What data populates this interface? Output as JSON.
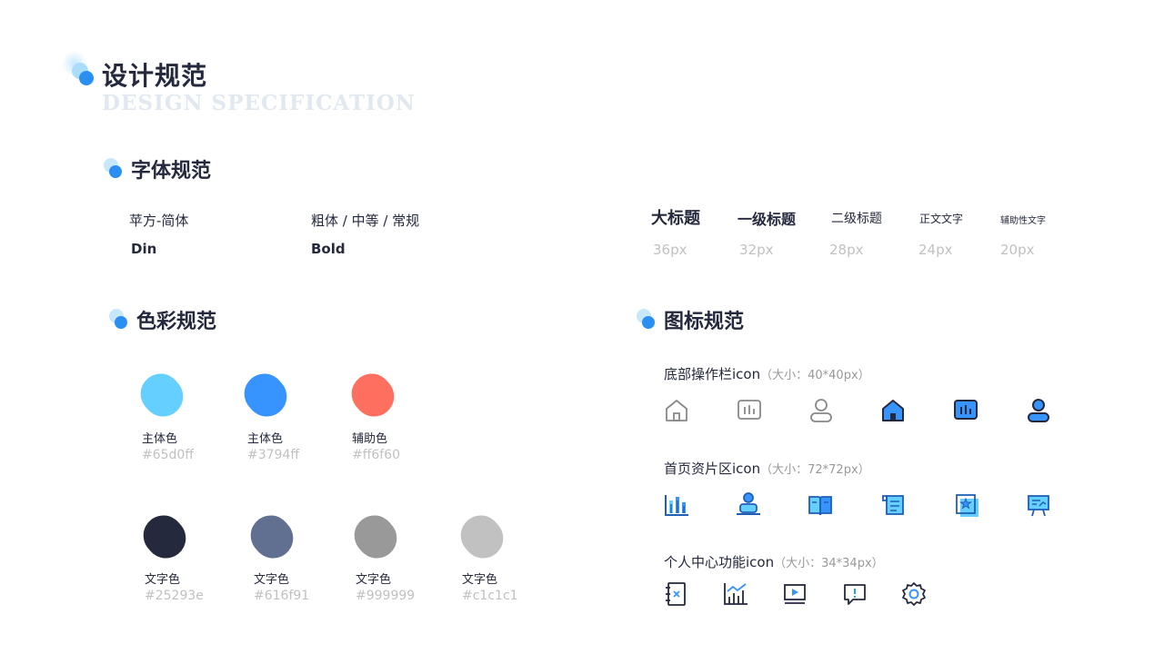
{
  "header": {
    "title": "设计规范",
    "subtitle": "DESIGN SPECIFICATION"
  },
  "fonts": {
    "title": "字体规范",
    "family_cn": "苹方-简体",
    "family_en": "Din",
    "weights_cn": "粗体 / 中等 / 常规",
    "weights_en": "Bold",
    "sizes": [
      {
        "name": "大标题",
        "value": "36px"
      },
      {
        "name": "一级标题",
        "value": "32px"
      },
      {
        "name": "二级标题",
        "value": "28px"
      },
      {
        "name": "正文文字",
        "value": "24px"
      },
      {
        "name": "辅助性文字",
        "value": "20px"
      }
    ]
  },
  "colors": {
    "title": "色彩规范",
    "items": [
      {
        "name": "主体色",
        "hex": "#65d0ff",
        "color": "#65d0ff"
      },
      {
        "name": "主体色",
        "hex": "#3794ff",
        "color": "#3794ff"
      },
      {
        "name": "辅助色",
        "hex": "#ff6f60",
        "color": "#ff6f60"
      },
      {
        "name": "文字色",
        "hex": "#25293e",
        "color": "#25293e"
      },
      {
        "name": "文字色",
        "hex": "#616f91",
        "color": "#616f91"
      },
      {
        "name": "文字色",
        "hex": "#999999",
        "color": "#999999"
      },
      {
        "name": "文字色",
        "hex": "#c1c1c1",
        "color": "#c1c1c1"
      }
    ]
  },
  "icons": {
    "title": "图标规范",
    "rows": [
      {
        "label": "底部操作栏icon",
        "size": "（大小：40*40px）",
        "icons": [
          "home-outline-icon",
          "chart-outline-icon",
          "user-outline-icon",
          "home-filled-icon",
          "chart-filled-icon",
          "user-filled-icon"
        ]
      },
      {
        "label": "首页资片区icon",
        "size": "（大小：72*72px）",
        "icons": [
          "bar-chart-icon",
          "teacher-icon",
          "open-book-icon",
          "scroll-icon",
          "star-book-icon",
          "presentation-board-icon"
        ]
      },
      {
        "label": "个人中心功能icon",
        "size": "（大小：34*34px）",
        "icons": [
          "notebook-icon",
          "trend-chart-icon",
          "video-play-icon",
          "message-alert-icon",
          "settings-gear-icon"
        ]
      }
    ]
  },
  "palette": {
    "accent": "#3794ff",
    "light": "#65d0ff",
    "dark": "#25293e"
  }
}
